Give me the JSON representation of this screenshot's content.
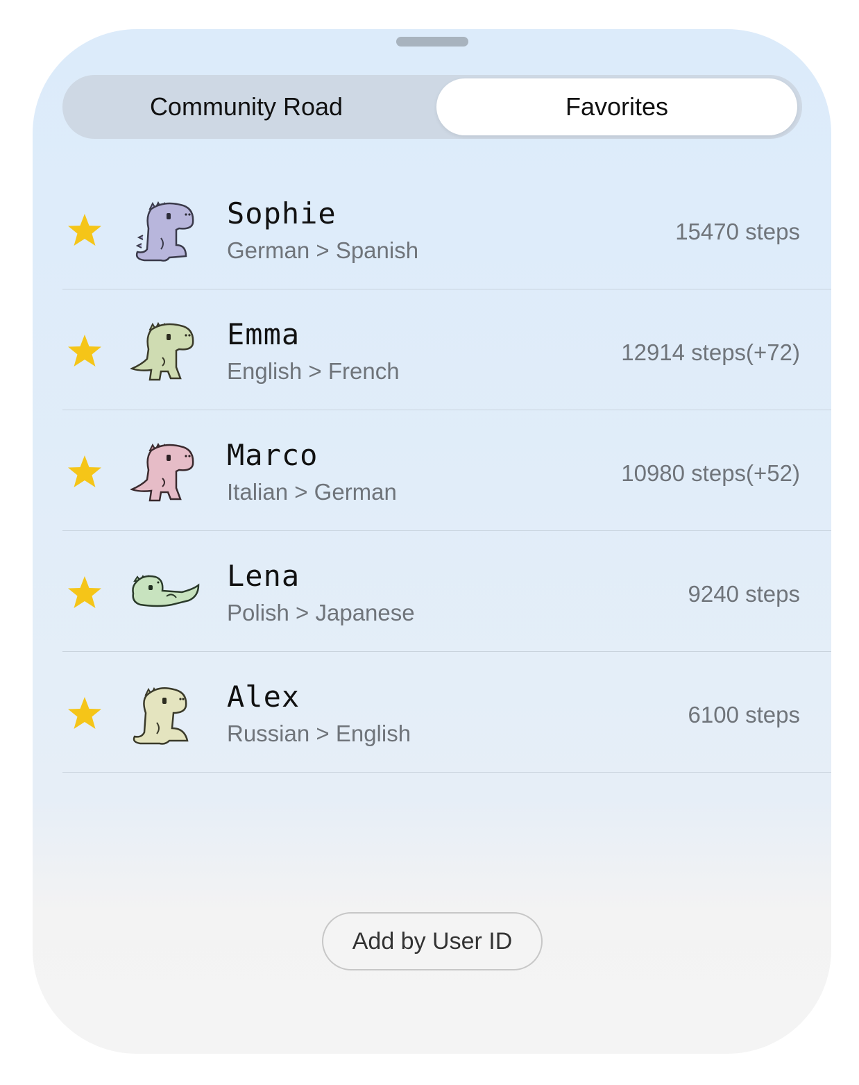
{
  "tabs": {
    "community_label": "Community Road",
    "favorites_label": "Favorites",
    "selected": "Favorites"
  },
  "favorites": [
    {
      "name": "Sophie",
      "languages": "German > Spanish",
      "steps": "15470 steps",
      "avatar": "purple-dino-sitting-icon",
      "color": "#b8b6dc"
    },
    {
      "name": "Emma",
      "languages": "English > French",
      "steps": "12914 steps(+72)",
      "avatar": "green-dino-standing-icon",
      "color": "#cfdcb2"
    },
    {
      "name": "Marco",
      "languages": "Italian > German",
      "steps": "10980 steps(+52)",
      "avatar": "pink-dino-standing-icon",
      "color": "#e6bcc7"
    },
    {
      "name": "Lena",
      "languages": "Polish > Japanese",
      "steps": "9240 steps",
      "avatar": "green-dino-lying-icon",
      "color": "#c8e3bf"
    },
    {
      "name": "Alex",
      "languages": "Russian > English",
      "steps": "6100 steps",
      "avatar": "beige-dino-sitting-icon",
      "color": "#e4e4bf"
    }
  ],
  "add_button_label": "Add by User ID",
  "colors": {
    "star": "#f5c518",
    "accent_bg": "#dcebfa"
  }
}
